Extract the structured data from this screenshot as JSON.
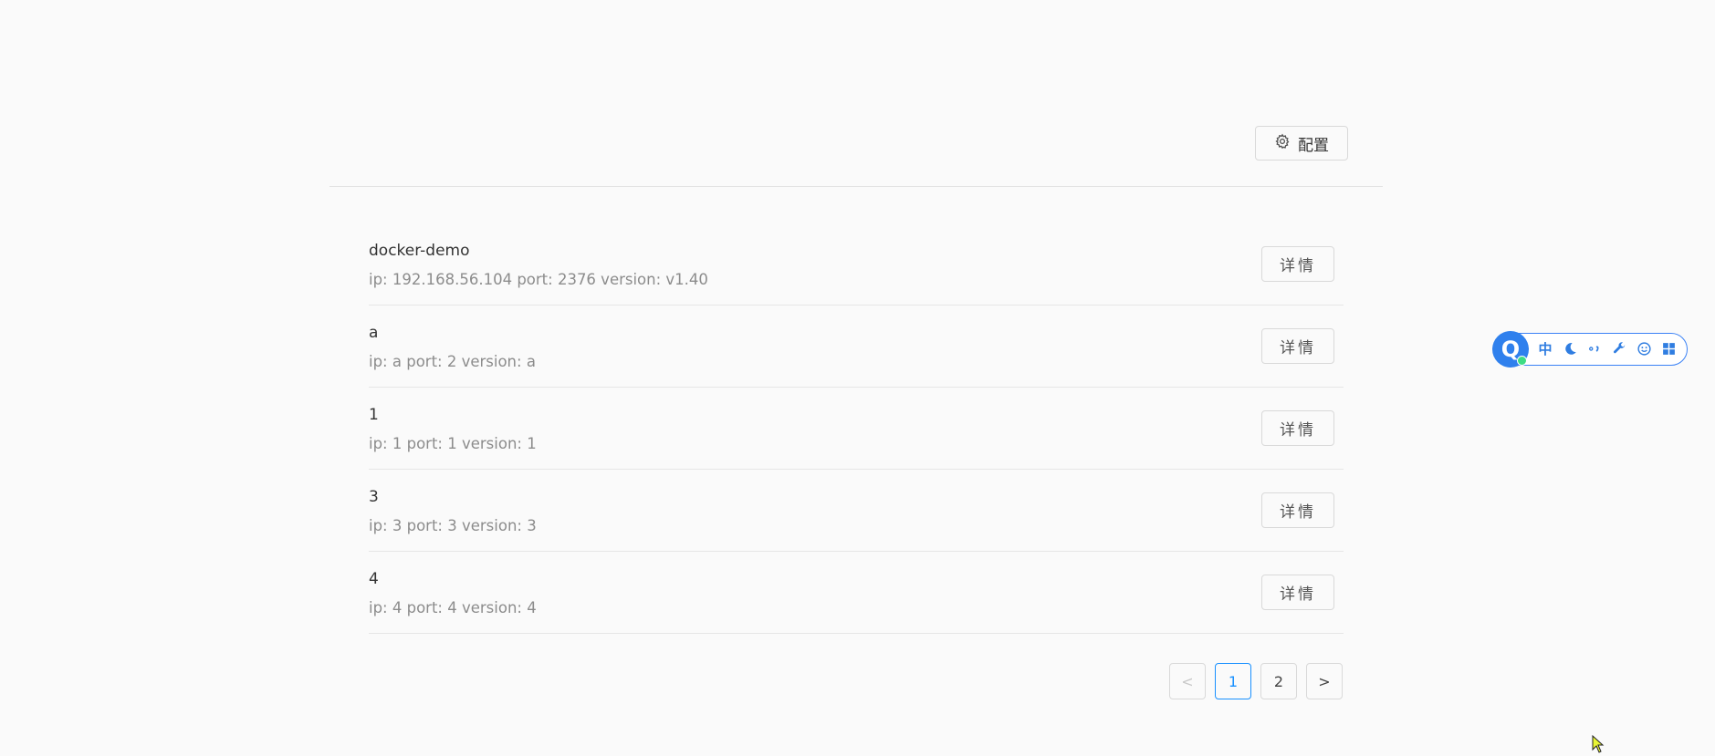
{
  "header": {
    "config_label": "配置"
  },
  "items": [
    {
      "title": "docker-demo",
      "desc": "ip: 192.168.56.104 port: 2376 version: v1.40",
      "button": "详情"
    },
    {
      "title": "a",
      "desc": "ip: a port: 2 version: a",
      "button": "详情"
    },
    {
      "title": "1",
      "desc": "ip: 1 port: 1 version: 1",
      "button": "详情"
    },
    {
      "title": "3",
      "desc": "ip: 3 port: 3 version: 3",
      "button": "详情"
    },
    {
      "title": "4",
      "desc": "ip: 4 port: 4 version: 4",
      "button": "详情"
    }
  ],
  "pagination": {
    "prev": "<",
    "pages": [
      "1",
      "2"
    ],
    "current": "1",
    "next": ">"
  },
  "ime": {
    "logo": "Q",
    "mode": "中",
    "icons": [
      "moon-icon",
      "punctuation-icon",
      "wrench-icon",
      "emoji-icon",
      "grid-icon"
    ],
    "accent": "#2f80ed"
  },
  "colors": {
    "accent": "#1890ff",
    "background": "#fafafa"
  }
}
